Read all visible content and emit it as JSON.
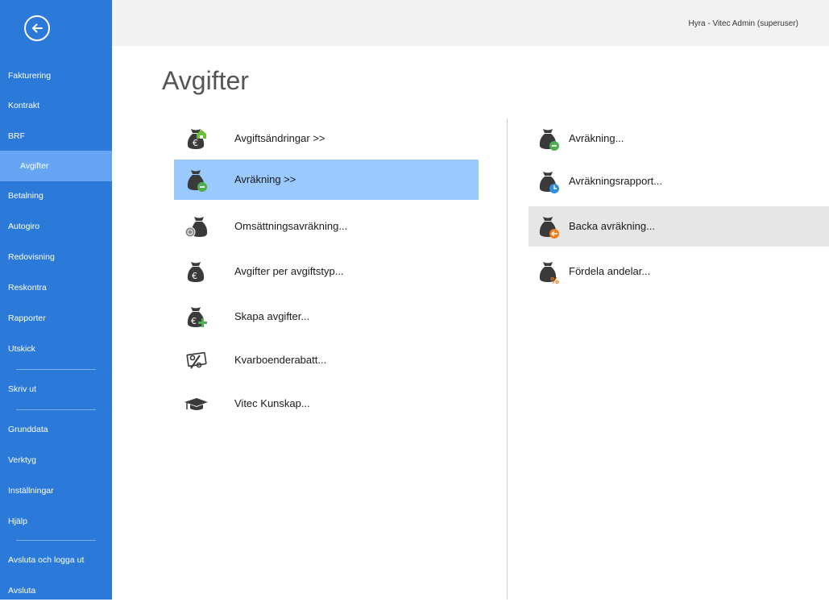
{
  "sidebar": {
    "back_icon": "back-arrow-circle-icon",
    "items": [
      {
        "label": "Fakturering"
      },
      {
        "label": "Kontrakt"
      },
      {
        "label": "BRF"
      },
      {
        "label": "Avgifter",
        "active": true
      },
      {
        "label": "Betalning"
      },
      {
        "label": "Autogiro"
      },
      {
        "label": "Redovisning"
      },
      {
        "label": "Reskontra"
      },
      {
        "label": "Rapporter"
      },
      {
        "label": "Utskick"
      },
      {
        "label": "Skriv ut"
      },
      {
        "label": "Grunddata"
      },
      {
        "label": "Verktyg"
      },
      {
        "label": "Inställningar"
      },
      {
        "label": "Hjälp"
      },
      {
        "label": "Avsluta och logga ut"
      },
      {
        "label": "Avsluta"
      }
    ]
  },
  "header": {
    "user_info": "Hyra - Vitec Admin (superuser)"
  },
  "main": {
    "title": "Avgifter",
    "left_commands": [
      {
        "label": "Avgiftsändringar >>",
        "icon": "moneybag-house-icon"
      },
      {
        "label": "Avräkning >>",
        "icon": "moneybag-minus-icon",
        "selected": true
      },
      {
        "label": "Omsättningsavräkning...",
        "icon": "moneybag-coins-icon"
      },
      {
        "label": "Avgifter per avgiftstyp...",
        "icon": "moneybag-euro-icon"
      },
      {
        "label": "Skapa avgifter...",
        "icon": "moneybag-plus-icon"
      },
      {
        "label": "Kvarboenderabatt...",
        "icon": "discount-percent-icon"
      },
      {
        "label": "Vitec Kunskap...",
        "icon": "graduation-cap-icon"
      }
    ],
    "right_commands": [
      {
        "label": "Avräkning...",
        "icon": "moneybag-minus-icon"
      },
      {
        "label": "Avräkningsrapport...",
        "icon": "moneybag-clock-icon"
      },
      {
        "label": "Backa avräkning...",
        "icon": "moneybag-back-arrow-icon",
        "hovered": true
      },
      {
        "label": "Fördela andelar...",
        "icon": "moneybag-percent-icon"
      }
    ]
  },
  "colors": {
    "sidebar_bg": "#2b79d8",
    "sidebar_active": "#66a5f3",
    "selected_bg": "#99c9ff",
    "hover_bg": "#e6e6e6",
    "icon_dark": "#3a3a3a",
    "badge_green": "#4caf50",
    "badge_blue": "#2f8fe0",
    "badge_orange": "#f07d1a"
  }
}
